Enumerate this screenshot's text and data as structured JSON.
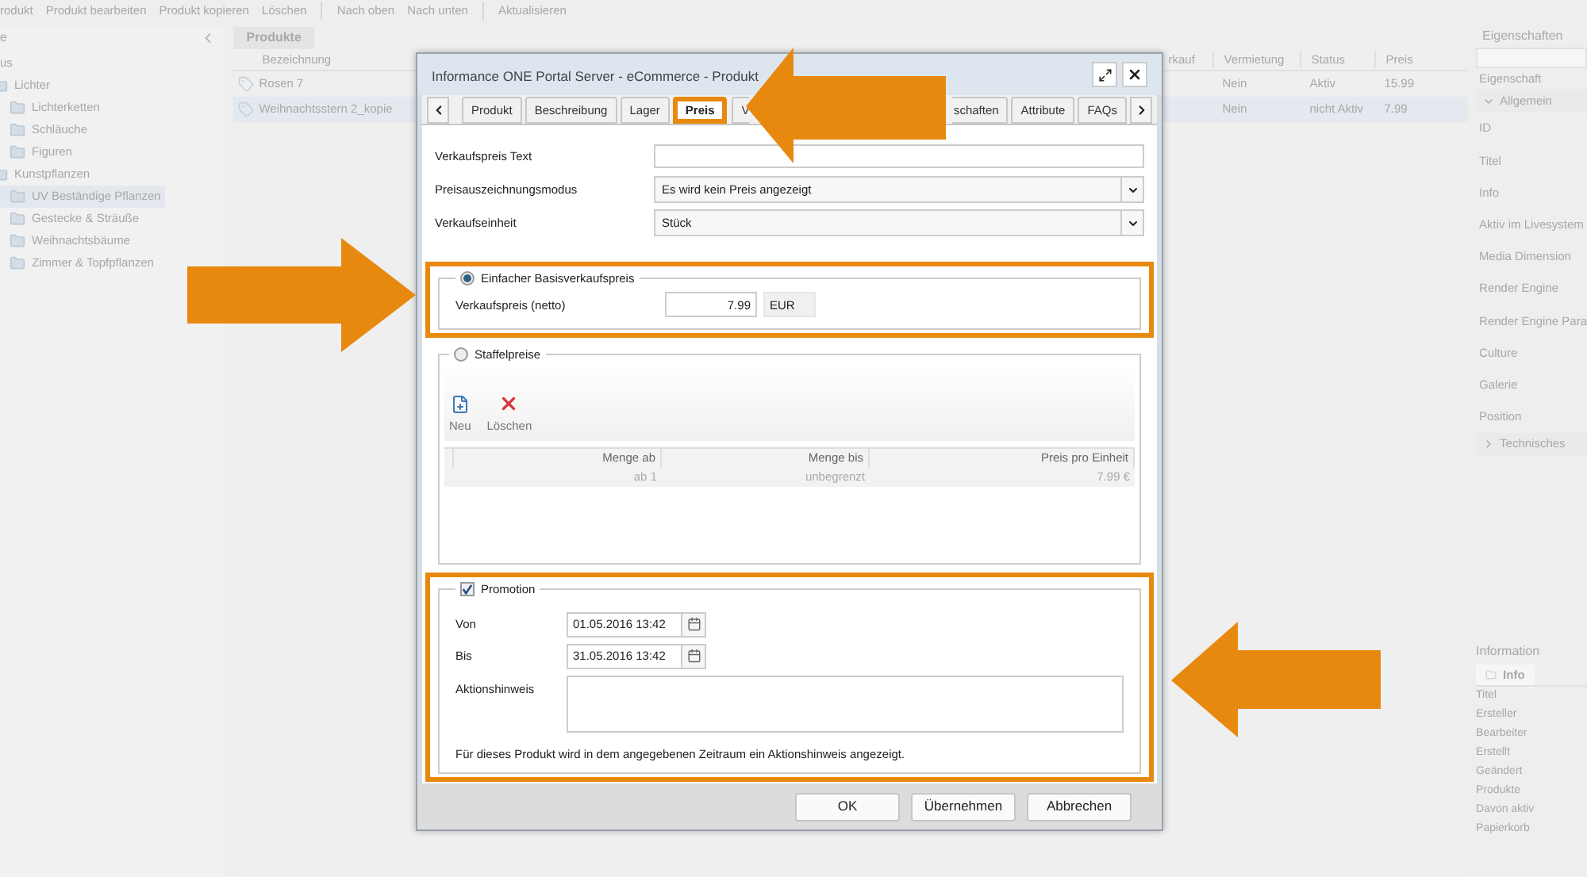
{
  "toolbar": {
    "groups": [
      [
        "rodukt",
        "Produkt bearbeiten",
        "Produkt kopieren",
        "Löschen"
      ],
      [
        "Nach oben",
        "Nach unten"
      ],
      [
        "Aktualisieren"
      ]
    ]
  },
  "tree_panel": {
    "header": "e",
    "tree": [
      {
        "label": "us",
        "selected": false,
        "children": [
          {
            "label": "Lichter",
            "selected": false,
            "children": [
              {
                "label": "Lichterketten",
                "selected": false
              },
              {
                "label": "Schläuche",
                "selected": false
              },
              {
                "label": "Figuren",
                "selected": false
              }
            ]
          },
          {
            "label": "Kunstpflanzen",
            "selected": false,
            "children": [
              {
                "label": "UV Beständige Pflanzen",
                "selected": true
              },
              {
                "label": "Gestecke & Sträuße",
                "selected": false
              },
              {
                "label": "Weihnachtsbäume",
                "selected": false
              },
              {
                "label": "Zimmer & Topfpflanzen",
                "selected": false
              }
            ]
          }
        ]
      }
    ]
  },
  "products": {
    "tab": "Produkte",
    "columns": [
      "Bezeichnung",
      "rkauf",
      "Vermietung",
      "Status",
      "Preis"
    ],
    "rows": [
      {
        "selected": false,
        "cells": [
          "Rosen 7",
          null,
          "Nein",
          "Aktiv",
          "15.99"
        ]
      },
      {
        "selected": true,
        "cells": [
          "Weihnachtsstern 2_kopie",
          null,
          "Nein",
          "nicht Aktiv",
          "7.99"
        ]
      }
    ]
  },
  "properties": {
    "title": "Eigenschaften",
    "column": "Eigenschaft",
    "groups": [
      {
        "label": "Allgemein",
        "expanded": true,
        "items": [
          "ID",
          "Titel",
          "Info",
          "Aktiv im Livesystem",
          "Media Dimension",
          "Render Engine",
          "Render Engine Para",
          "Culture",
          "Galerie",
          "Position"
        ]
      },
      {
        "label": "Technisches",
        "expanded": false
      }
    ]
  },
  "information": {
    "title": "Information",
    "tab": "Info",
    "items": [
      "Titel",
      "Ersteller",
      "Bearbeiter",
      "Erstellt",
      "Geändert",
      "Produkte",
      "Davon aktiv",
      "Papierkorb"
    ]
  },
  "dialog": {
    "title": "Informance ONE Portal Server - eCommerce - Produkt",
    "tabs": [
      {
        "label": "Produkt",
        "selected": false,
        "highlighted": false
      },
      {
        "label": "Beschreibung",
        "selected": false,
        "highlighted": false
      },
      {
        "label": "Lager",
        "selected": false,
        "highlighted": false
      },
      {
        "label": "Preis",
        "selected": true,
        "highlighted": true
      },
      {
        "label": "V",
        "selected": false,
        "highlighted": false
      }
    ],
    "tabs_right": [
      {
        "label": "schaften",
        "selected": false,
        "highlighted": false
      },
      {
        "label": "Attribute",
        "selected": false,
        "highlighted": false
      },
      {
        "label": "FAQs",
        "selected": false,
        "highlighted": false
      }
    ],
    "fields": [
      {
        "kind": "text",
        "label": "Verkaufspreis Text"
      },
      {
        "kind": "select",
        "label": "Preisauszeichnungsmodus",
        "value": "Es wird kein Preis angezeigt"
      },
      {
        "kind": "select",
        "label": "Verkaufseinheit",
        "value": "Stück"
      }
    ],
    "basic": {
      "legend": "Einfacher Basisverkaufspreis",
      "selected": true,
      "highlighted": true,
      "label": "Verkaufspreis (netto)",
      "value": "7.99",
      "currency": "EUR"
    },
    "staffel": {
      "legend": "Staffelpreise",
      "selected": false,
      "highlighted": false,
      "actions": [
        {
          "kind": "new",
          "label": "Neu"
        },
        {
          "kind": "delete",
          "label": "Löschen"
        }
      ],
      "columns": [
        "Menge ab",
        "Menge bis",
        "Preis pro Einheit"
      ],
      "rows": [
        [
          "ab 1",
          "unbegrenzt",
          "7.99 €"
        ]
      ]
    },
    "promotion": {
      "legend": "Promotion",
      "checked": true,
      "highlighted": true,
      "von_label": "Von",
      "von": "01.05.2016 13:42",
      "bis_label": "Bis",
      "bis": "31.05.2016 13:42",
      "hint_label": "Aktionshinweis",
      "note": "Für dieses Produkt wird in dem angegebenen Zeitraum ein Aktionshinweis angezeigt."
    },
    "buttons": [
      "OK",
      "Übernehmen",
      "Abbrechen"
    ]
  }
}
